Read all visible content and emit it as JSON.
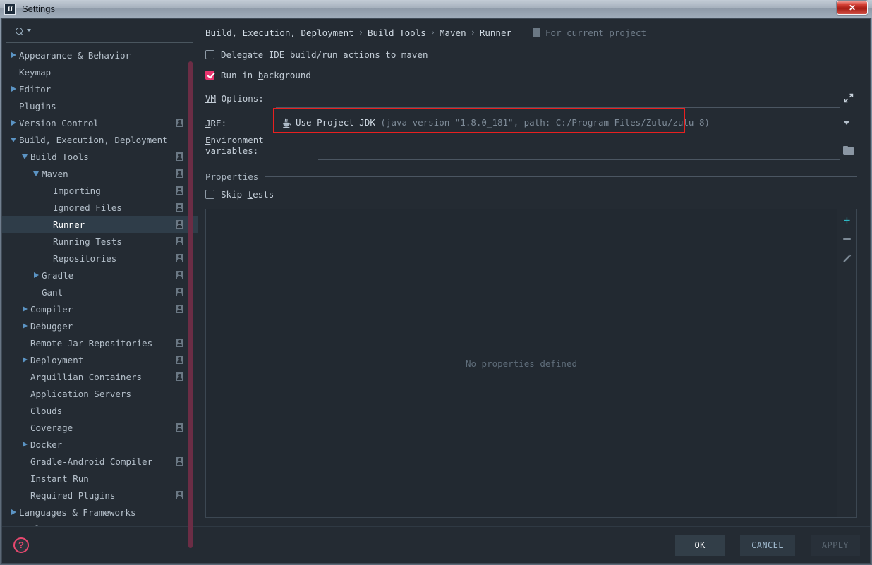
{
  "window": {
    "title": "Settings",
    "logo_text": "IJ",
    "close_label": "✕"
  },
  "search": {
    "value": "",
    "placeholder": ""
  },
  "sidebar": {
    "items": [
      {
        "label": "Appearance & Behavior",
        "indent": 0,
        "arrow": "right",
        "person": false,
        "selected": false
      },
      {
        "label": "Keymap",
        "indent": 0,
        "arrow": "none",
        "person": false,
        "selected": false
      },
      {
        "label": "Editor",
        "indent": 0,
        "arrow": "right",
        "person": false,
        "selected": false
      },
      {
        "label": "Plugins",
        "indent": 0,
        "arrow": "none",
        "person": false,
        "selected": false
      },
      {
        "label": "Version Control",
        "indent": 0,
        "arrow": "right",
        "person": true,
        "selected": false
      },
      {
        "label": "Build, Execution, Deployment",
        "indent": 0,
        "arrow": "down",
        "person": false,
        "selected": false
      },
      {
        "label": "Build Tools",
        "indent": 1,
        "arrow": "down",
        "person": true,
        "selected": false
      },
      {
        "label": "Maven",
        "indent": 2,
        "arrow": "down",
        "person": true,
        "selected": false
      },
      {
        "label": "Importing",
        "indent": 3,
        "arrow": "none",
        "person": true,
        "selected": false
      },
      {
        "label": "Ignored Files",
        "indent": 3,
        "arrow": "none",
        "person": true,
        "selected": false
      },
      {
        "label": "Runner",
        "indent": 3,
        "arrow": "none",
        "person": true,
        "selected": true
      },
      {
        "label": "Running Tests",
        "indent": 3,
        "arrow": "none",
        "person": true,
        "selected": false
      },
      {
        "label": "Repositories",
        "indent": 3,
        "arrow": "none",
        "person": true,
        "selected": false
      },
      {
        "label": "Gradle",
        "indent": 2,
        "arrow": "right",
        "person": true,
        "selected": false
      },
      {
        "label": "Gant",
        "indent": 2,
        "arrow": "none",
        "person": true,
        "selected": false
      },
      {
        "label": "Compiler",
        "indent": 1,
        "arrow": "right",
        "person": true,
        "selected": false
      },
      {
        "label": "Debugger",
        "indent": 1,
        "arrow": "right",
        "person": false,
        "selected": false
      },
      {
        "label": "Remote Jar Repositories",
        "indent": 1,
        "arrow": "none",
        "person": true,
        "selected": false
      },
      {
        "label": "Deployment",
        "indent": 1,
        "arrow": "right",
        "person": true,
        "selected": false
      },
      {
        "label": "Arquillian Containers",
        "indent": 1,
        "arrow": "none",
        "person": true,
        "selected": false
      },
      {
        "label": "Application Servers",
        "indent": 1,
        "arrow": "none",
        "person": false,
        "selected": false
      },
      {
        "label": "Clouds",
        "indent": 1,
        "arrow": "none",
        "person": false,
        "selected": false
      },
      {
        "label": "Coverage",
        "indent": 1,
        "arrow": "none",
        "person": true,
        "selected": false
      },
      {
        "label": "Docker",
        "indent": 1,
        "arrow": "right",
        "person": false,
        "selected": false
      },
      {
        "label": "Gradle-Android Compiler",
        "indent": 1,
        "arrow": "none",
        "person": true,
        "selected": false
      },
      {
        "label": "Instant Run",
        "indent": 1,
        "arrow": "none",
        "person": false,
        "selected": false
      },
      {
        "label": "Required Plugins",
        "indent": 1,
        "arrow": "none",
        "person": true,
        "selected": false
      },
      {
        "label": "Languages & Frameworks",
        "indent": 0,
        "arrow": "right",
        "person": false,
        "selected": false
      },
      {
        "label": "Tools",
        "indent": 0,
        "arrow": "right",
        "person": false,
        "selected": false
      }
    ]
  },
  "content": {
    "breadcrumb": [
      "Build, Execution, Deployment",
      "Build Tools",
      "Maven",
      "Runner"
    ],
    "breadcrumb_separator": "›",
    "for_current_project": "For current project",
    "delegate_checkbox": {
      "label_pre": "",
      "mnemonic": "D",
      "label_post": "elegate IDE build/run actions to maven",
      "checked": false
    },
    "run_background_checkbox": {
      "label_pre": "Run in ",
      "mnemonic": "b",
      "label_post": "ackground",
      "checked": true
    },
    "vm_options": {
      "label_pre": "",
      "mnemonic": "VM",
      "label_post": " Options:",
      "value": ""
    },
    "jre": {
      "label_pre": "",
      "mnemonic": "J",
      "label_post": "RE:",
      "value_main": "Use Project JDK ",
      "value_detail": "(java version \"1.8.0_181\", path: C:/Program Files/Zulu/zulu-8)",
      "highlight_color": "#e82020"
    },
    "environment_variables": {
      "label_pre": "",
      "mnemonic": "E",
      "label_post": "nvironment variables:",
      "value": ""
    },
    "properties_section": {
      "title": "Properties",
      "skip_tests": {
        "label_pre": "Skip ",
        "mnemonic": "t",
        "label_post": "ests",
        "checked": false
      },
      "empty_text": "No properties defined",
      "toolbar": {
        "add_label": "+",
        "remove_label": "−",
        "edit_label": "edit"
      }
    }
  },
  "footer": {
    "help_label": "?",
    "ok_label": "OK",
    "cancel_label": "CANCEL",
    "apply_label": "APPLY"
  },
  "colors": {
    "accent_pink": "#e8346f",
    "accent_teal": "#2eb8c4",
    "highlight_red": "#e82020",
    "scrollbar": "#6b2d45",
    "bg": "#242b33"
  }
}
